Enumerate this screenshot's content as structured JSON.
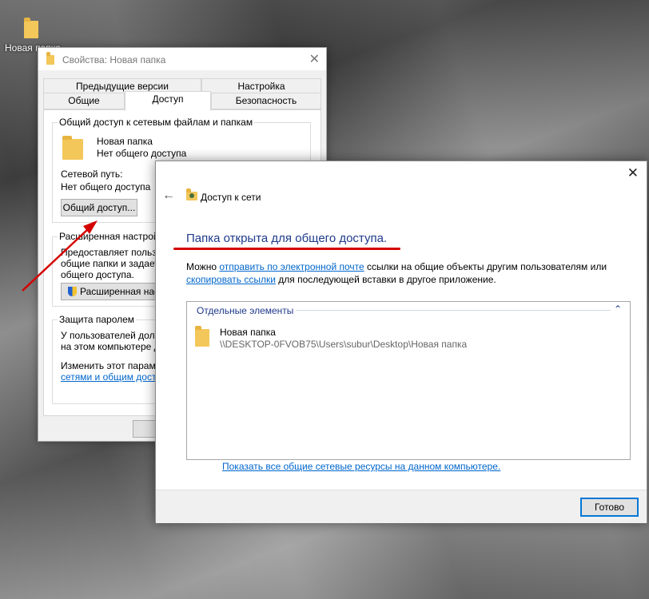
{
  "desktop": {
    "icon_label": "Новая папка"
  },
  "properties": {
    "title": "Свойства: Новая папка",
    "tabs_top": [
      "Предыдущие версии",
      "Настройка"
    ],
    "tabs_bottom": [
      "Общие",
      "Доступ",
      "Безопасность"
    ],
    "sharing": {
      "group_label": "Общий доступ к сетевым файлам и папкам",
      "folder_name": "Новая папка",
      "folder_status": "Нет общего доступа",
      "path_label": "Сетевой путь:",
      "path_value": "Нет общего доступа",
      "share_button": "Общий доступ..."
    },
    "advanced": {
      "label": "Расширенная настрой",
      "desc_lines": [
        "Предоставляет пользо",
        "общие папки и задает",
        "общего доступа."
      ],
      "button": "Расширенная нас"
    },
    "password": {
      "label": "Защита паролем",
      "lines": [
        "У пользователей долж",
        "на этом компьютере д"
      ],
      "change_line": "Изменить этот параме",
      "change_link": "сетями и общим досту"
    }
  },
  "dialog": {
    "title": "Доступ к сети",
    "heading": "Папка открыта для общего доступа.",
    "desc_prefix": "Можно ",
    "desc_link1": "отправить по электронной почте",
    "desc_mid": " ссылки на общие объекты другим пользователям или",
    "desc_link2": "скопировать ссылки",
    "desc_suffix": " для последующей вставки в другое приложение.",
    "list_header": "Отдельные элементы",
    "item_name": "Новая папка",
    "item_path": "\\\\DESKTOP-0FVOB75\\Users\\subur\\Desktop\\Новая папка",
    "show_all_link": "Показать все общие сетевые ресурсы на данном компьютере.",
    "done_button": "Готово"
  },
  "icons": {
    "close": "close-icon",
    "back": "back-arrow-icon",
    "network": "network-share-icon",
    "collapse": "chevron-up-icon",
    "shield": "uac-shield-icon"
  },
  "colors": {
    "accent": "#0078d7",
    "heading": "#1e3a8a",
    "annotation": "#d40000"
  }
}
